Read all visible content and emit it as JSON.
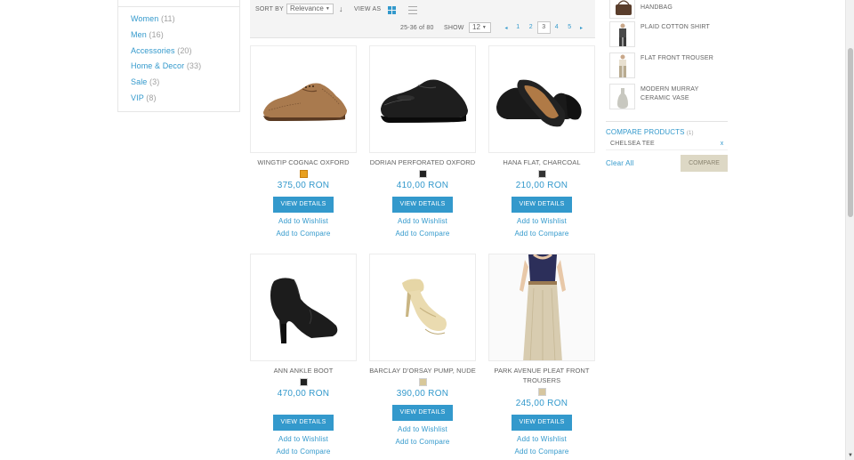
{
  "categories": [
    {
      "name": "Women",
      "count": "(11)"
    },
    {
      "name": "Men",
      "count": "(16)"
    },
    {
      "name": "Accessories",
      "count": "(20)"
    },
    {
      "name": "Home & Decor",
      "count": "(33)"
    },
    {
      "name": "Sale",
      "count": "(3)"
    },
    {
      "name": "VIP",
      "count": "(8)"
    }
  ],
  "toolbar": {
    "sort_label": "SORT BY",
    "sort_value": "Relevance",
    "sort_direction_icon": "down-arrow-icon",
    "view_label": "VIEW AS",
    "count_text": "25-36 of 80",
    "show_label": "SHOW",
    "show_value": "12",
    "pages": [
      "1",
      "2",
      "3",
      "4",
      "5"
    ],
    "current_page": "3"
  },
  "products": [
    {
      "name": "WINGTIP COGNAC OXFORD",
      "swatch": "#e8a020",
      "price": "375,00 RON",
      "image": "cognac-oxford-shoe"
    },
    {
      "name": "DORIAN PERFORATED OXFORD",
      "swatch": "#222222",
      "price": "410,00 RON",
      "image": "black-oxford-shoe"
    },
    {
      "name": "HANA FLAT, CHARCOAL",
      "swatch": "#333333",
      "price": "210,00 RON",
      "image": "charcoal-flat-shoe"
    },
    {
      "name": "ANN ANKLE BOOT",
      "swatch": "#222222",
      "price": "470,00 RON",
      "image": "black-ankle-boot"
    },
    {
      "name": "BARCLAY D'ORSAY PUMP, NUDE",
      "swatch": "#d8c89a",
      "price": "390,00 RON",
      "image": "nude-pump-shoe"
    },
    {
      "name": "PARK AVENUE PLEAT FRONT TROUSERS",
      "swatch": "#d6c6a0",
      "price": "245,00 RON",
      "image": "pleat-trousers-model"
    }
  ],
  "product_actions": {
    "view_details": "VIEW DETAILS",
    "add_wishlist": "Add to Wishlist",
    "add_compare": "Add to Compare"
  },
  "recent_items": [
    {
      "name": "ISLA CROSSBODY HANDBAG",
      "image": "handbag"
    },
    {
      "name": "PLAID COTTON SHIRT",
      "image": "shirt-model"
    },
    {
      "name": "FLAT FRONT TROUSER",
      "image": "trouser-model"
    },
    {
      "name": "MODERN MURRAY CERAMIC VASE",
      "image": "ceramic-vase"
    }
  ],
  "compare": {
    "title": "COMPARE PRODUCTS",
    "count": "(1)",
    "items": [
      "CHELSEA TEE"
    ],
    "remove_label": "x",
    "clear_all": "Clear All",
    "button": "COMPARE"
  },
  "colors": {
    "accent": "#3399cc",
    "compare_button": "#ddd8c5"
  }
}
